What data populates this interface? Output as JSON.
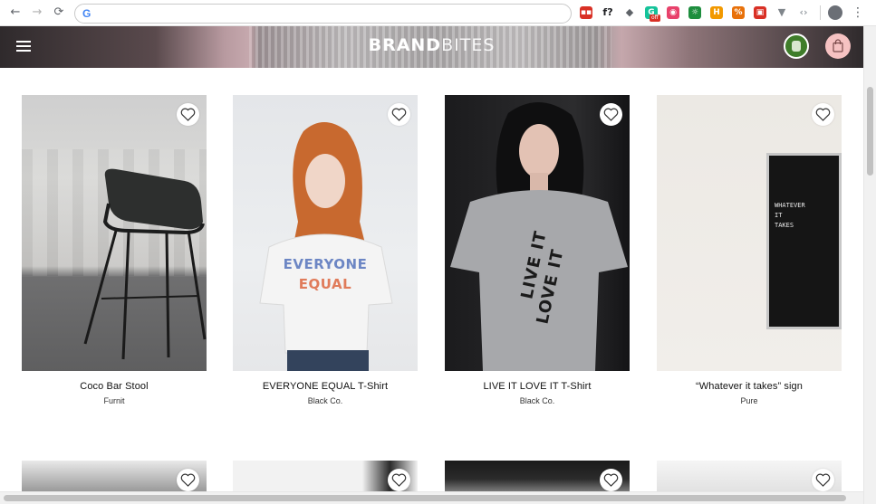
{
  "browser": {
    "nav": {
      "back_icon": "←",
      "forward_icon": "→",
      "reload_icon": "⟳"
    },
    "omnibox": {
      "search_glyph": "G",
      "value": ""
    },
    "extensions": [
      {
        "name": "extension-red-icon",
        "glyph": "▪▪",
        "color": "#d93025"
      },
      {
        "name": "extension-fx-icon",
        "glyph": "f?",
        "color": "#202124"
      },
      {
        "name": "extension-shield-icon",
        "glyph": "◆",
        "color": "#5f6368"
      },
      {
        "name": "extension-grammarly-icon",
        "glyph": "G",
        "color": "#15c39a"
      },
      {
        "name": "extension-pink-icon",
        "glyph": "◉",
        "color": "#e8416b"
      },
      {
        "name": "extension-green-icon",
        "glyph": "☼",
        "color": "#1e8e3e"
      },
      {
        "name": "extension-h-icon",
        "glyph": "H",
        "color": "#f29900"
      },
      {
        "name": "extension-percent-icon",
        "glyph": "%",
        "color": "#e8710a"
      },
      {
        "name": "extension-picture-icon",
        "glyph": "▣",
        "color": "#d93025"
      },
      {
        "name": "extension-vue-icon",
        "glyph": "▼",
        "color": "#80868b"
      },
      {
        "name": "extension-code-icon",
        "glyph": "‹›",
        "color": "#9aa0a6"
      }
    ],
    "grammarly_badge": "off",
    "menu_icon": "⋮"
  },
  "header": {
    "logo_bold": "BRAND",
    "logo_light": "BITES"
  },
  "products": [
    {
      "name": "Coco Bar Stool",
      "brand": "Furnit"
    },
    {
      "name": "EVERYONE EQUAL T-Shirt",
      "brand": "Black Co.",
      "print_line1": "EVERYONE",
      "print_line2": "EQUAL"
    },
    {
      "name": "LIVE IT LOVE IT T-Shirt",
      "brand": "Black Co.",
      "print_line1": "LIVE IT",
      "print_line2": "LOVE IT"
    },
    {
      "name": "“Whatever it takes” sign",
      "brand": "Pure",
      "sign_text": "WHATEVER\nIT\nTAKES"
    }
  ],
  "colors": {
    "cart_button": "#f6c2c2",
    "avatar": "#3f7d2a"
  }
}
